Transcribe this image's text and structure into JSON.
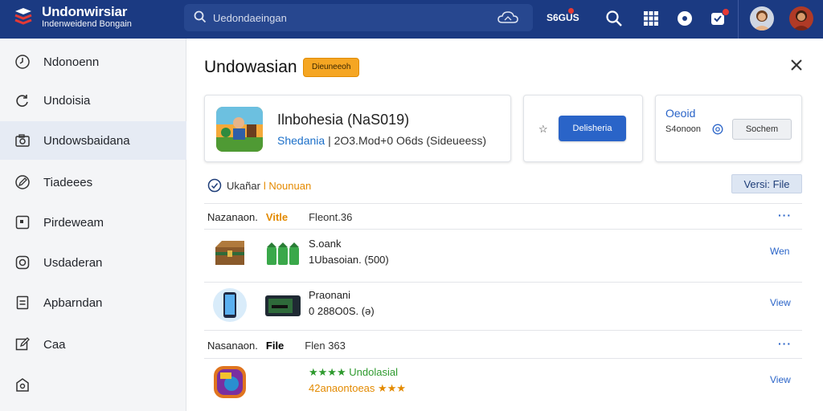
{
  "header": {
    "brand_title": "Undonwirsiar",
    "brand_subtitle": "Indenweidend Bongain",
    "search_placeholder": "Uedondaeingan",
    "status_label": "S6GUS",
    "brand_color": "#1b3a82",
    "icons": [
      "search-icon",
      "grid-icon",
      "record-icon",
      "notification-icon"
    ]
  },
  "sidebar": {
    "items": [
      {
        "label": "Ndonoenn",
        "icon": "clock-icon"
      },
      {
        "label": "Undoisia",
        "icon": "refresh-icon"
      },
      {
        "label": "Undowsbaidana",
        "icon": "camera-icon"
      },
      {
        "label": "Tiadeees",
        "icon": "edit-icon"
      },
      {
        "label": "Pirdeweam",
        "icon": "window-icon"
      },
      {
        "label": "Usdaderan",
        "icon": "instagram-icon"
      },
      {
        "label": "Apbarndan",
        "icon": "document-icon"
      },
      {
        "label": "Caa",
        "icon": "pencil-icon"
      },
      {
        "label": "",
        "icon": "bag-icon"
      }
    ],
    "active_index": 2
  },
  "main": {
    "title": "Undowasian",
    "tag": "Dieuneeoh",
    "app": {
      "name": "Ilnbohesia (NaS019)",
      "publisher": "Shedania",
      "meta": "| 2O3.Mod+0 O6ds (Sideueess)"
    },
    "card2": {
      "star": "☆",
      "button": "Delisheria"
    },
    "card3": {
      "title": "Oeoid",
      "subtitle": "S4onoon",
      "button": "Sochem"
    },
    "status": {
      "label": "Ukañar",
      "tag": "l Nounuan"
    },
    "version_button": "Versi: File",
    "section1": {
      "name": "Nazanaon.",
      "col": "Vitle",
      "col2": "Fleont.36"
    },
    "section2": {
      "name": "Nasanaon.",
      "col": "File",
      "col2": "Flen 363"
    },
    "more": "···",
    "rows": [
      {
        "title": "S.oank",
        "detail": "1Ubasoian.  (500)",
        "view": "Wen"
      },
      {
        "title": "Praonani",
        "detail": "0 288O0S.  (ǝ)",
        "view": "View"
      },
      {
        "title": "Undolasial",
        "stars_prefix": "★★★★",
        "detail": "42anaontoeas",
        "stars_suffix": "★★★",
        "view": "View"
      }
    ]
  }
}
